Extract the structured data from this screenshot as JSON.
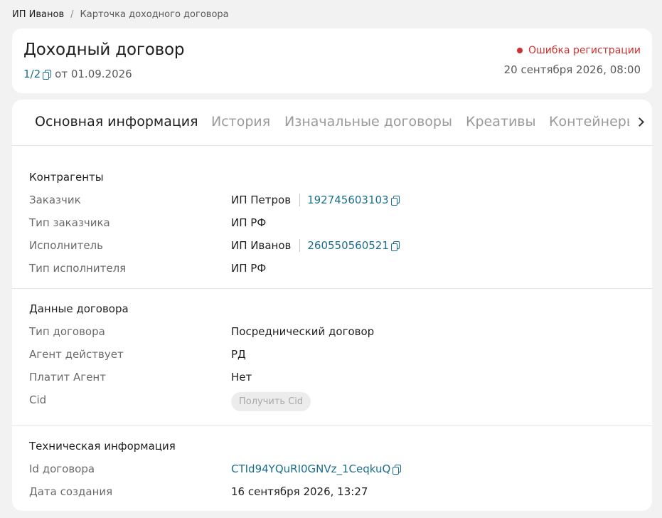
{
  "breadcrumb": {
    "root": "ИП Иванов",
    "separator": "/",
    "current": "Карточка доходного договора"
  },
  "header": {
    "title": "Доходный договор",
    "counter": "1/2",
    "date_prefix": "от",
    "date": "01.09.2026",
    "status": "Ошибка регистрации",
    "status_color": "#d12f2f",
    "datetime": "20 сентября 2026, 08:00"
  },
  "tabs": [
    "Основная информация",
    "История",
    "Изначальные договоры",
    "Креативы",
    "Контейнеры"
  ],
  "sections": {
    "counterparties": {
      "title": "Контрагенты",
      "customer_label": "Заказчик",
      "customer_name": "ИП Петров",
      "customer_inn": "192745603103",
      "customer_type_label": "Тип заказчика",
      "customer_type": "ИП РФ",
      "executor_label": "Исполнитель",
      "executor_name": "ИП Иванов",
      "executor_inn": "260550560521",
      "executor_type_label": "Тип исполнителя",
      "executor_type": "ИП РФ"
    },
    "contract": {
      "title": "Данные договора",
      "type_label": "Тип договора",
      "type": "Посреднический договор",
      "agent_acts_label": "Агент действует",
      "agent_acts": "РД",
      "agent_pays_label": "Платит Агент",
      "agent_pays": "Нет",
      "cid_label": "Cid",
      "cid_button": "Получить Cid"
    },
    "technical": {
      "title": "Техническая информация",
      "id_label": "Id договора",
      "id": "CTId94YQuRI0GNVz_1CeqkuQ",
      "created_label": "Дата создания",
      "created": "16 сентября 2026, 13:27"
    }
  },
  "colors": {
    "link": "#1c6e8c",
    "background": "#f2f2f2",
    "card": "#ffffff"
  }
}
